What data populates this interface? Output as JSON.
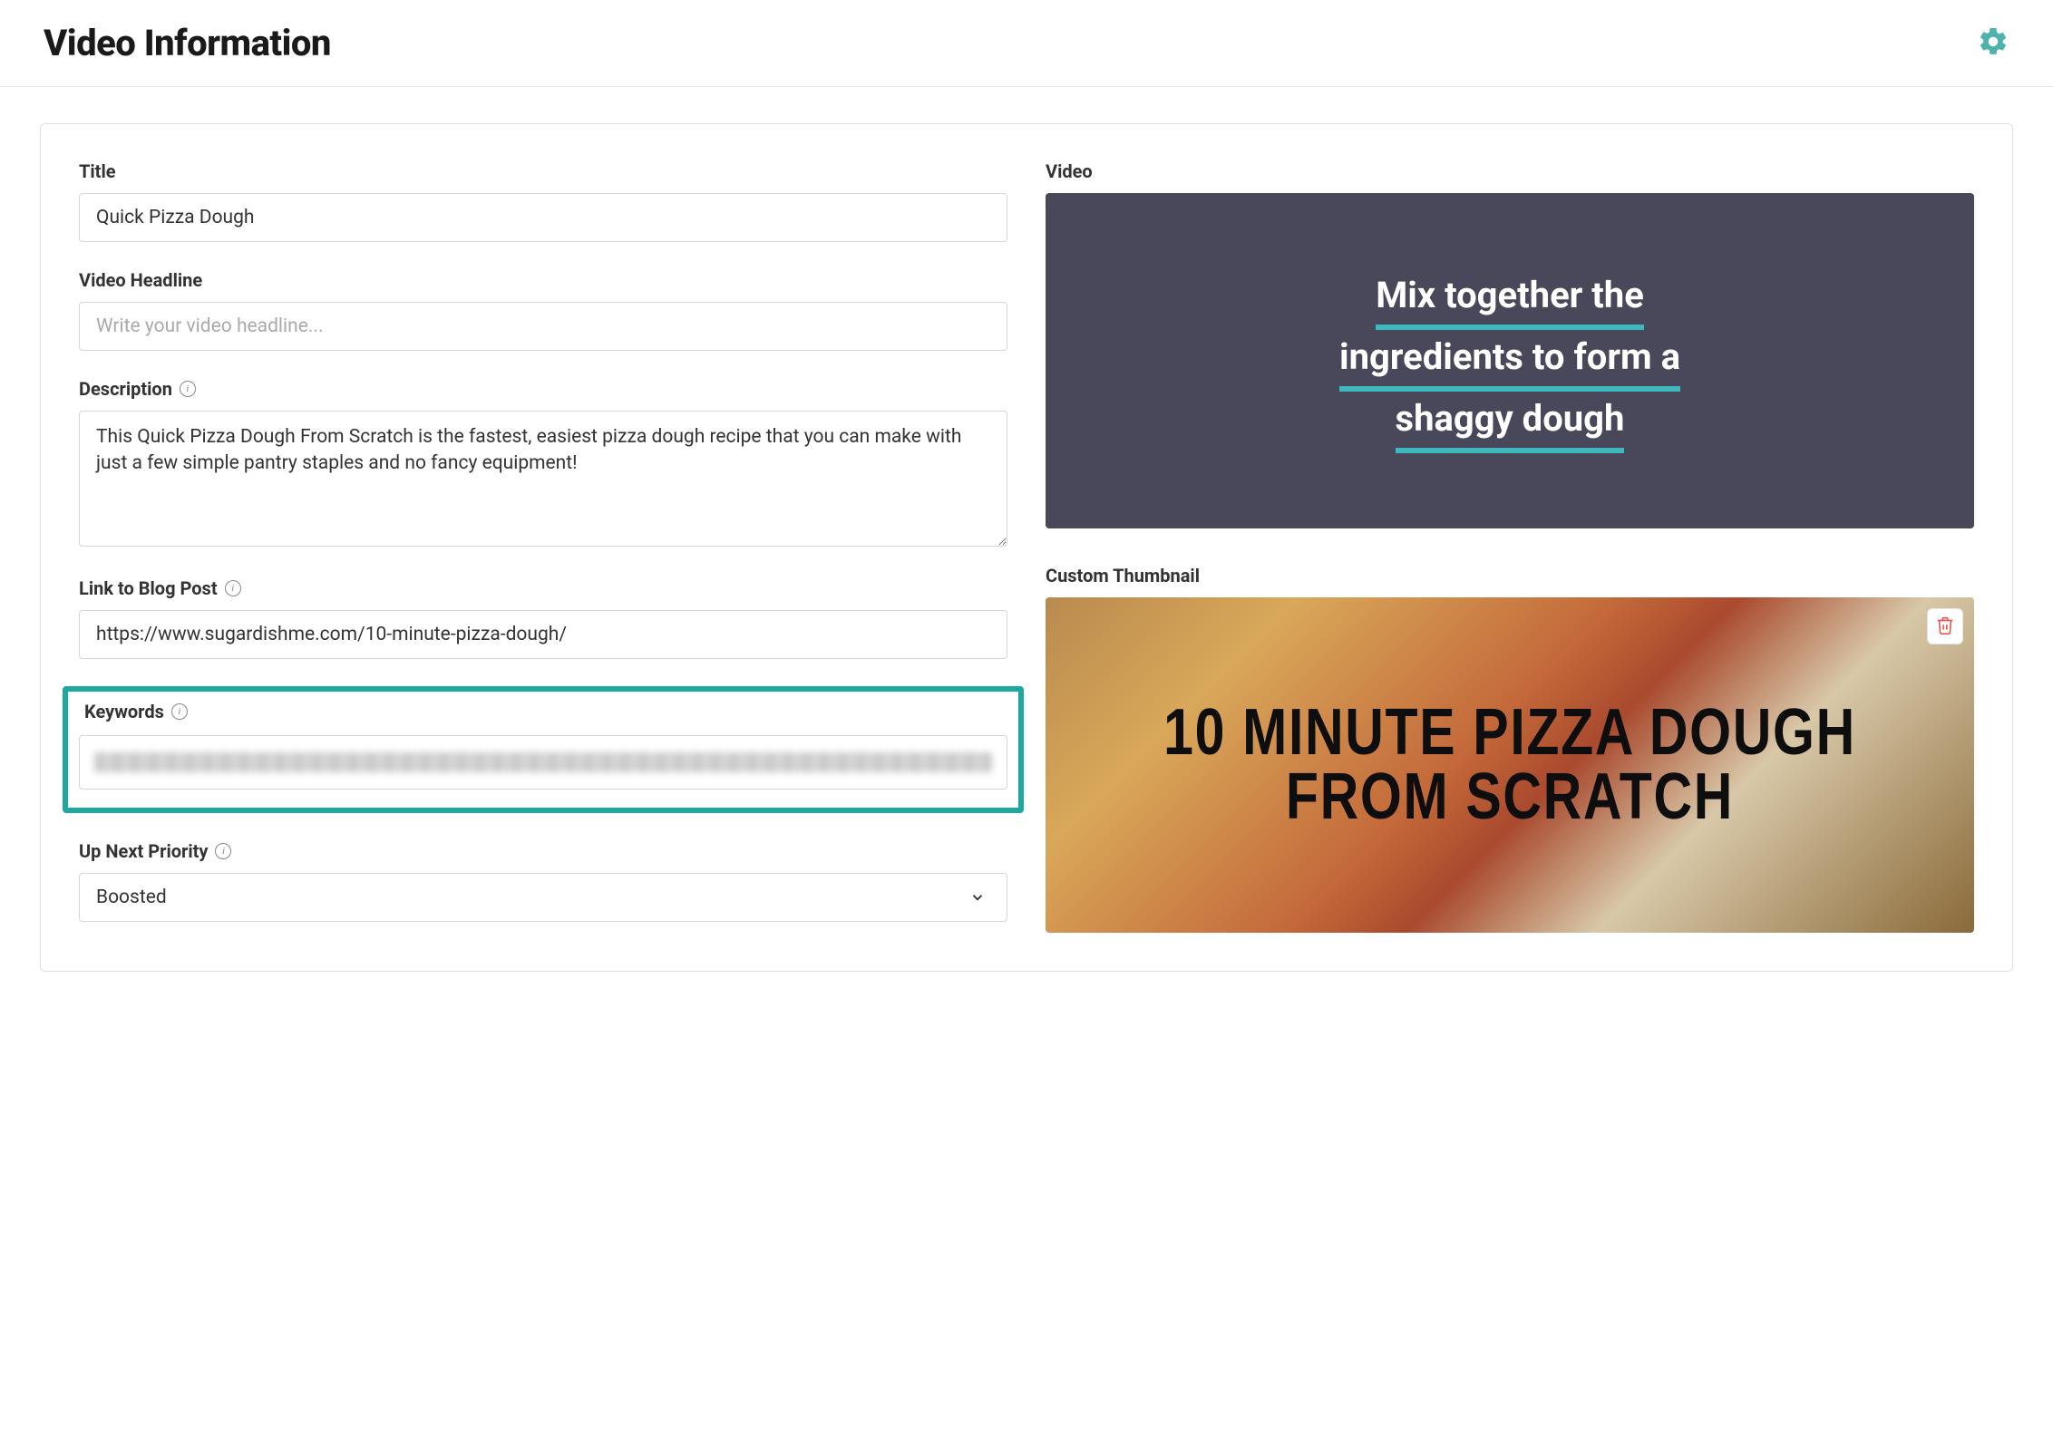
{
  "header": {
    "title": "Video Information"
  },
  "form": {
    "title_label": "Title",
    "title_value": "Quick Pizza Dough",
    "headline_label": "Video Headline",
    "headline_placeholder": "Write your video headline...",
    "headline_value": "",
    "description_label": "Description",
    "description_value": "This Quick Pizza Dough From Scratch is the fastest, easiest pizza dough recipe that you can make with just a few simple pantry staples and no fancy equipment!",
    "link_label": "Link to Blog Post",
    "link_value": "https://www.sugardishme.com/10-minute-pizza-dough/",
    "keywords_label": "Keywords",
    "upnext_label": "Up Next Priority",
    "upnext_value": "Boosted",
    "video_label": "Video",
    "thumbnail_label": "Custom Thumbnail"
  },
  "video_preview": {
    "line1": "Mix together the",
    "line2": "ingredients to form a",
    "line3": "shaggy dough"
  },
  "thumbnail_text": "10 MINUTE PIZZA DOUGH FROM SCRATCH"
}
